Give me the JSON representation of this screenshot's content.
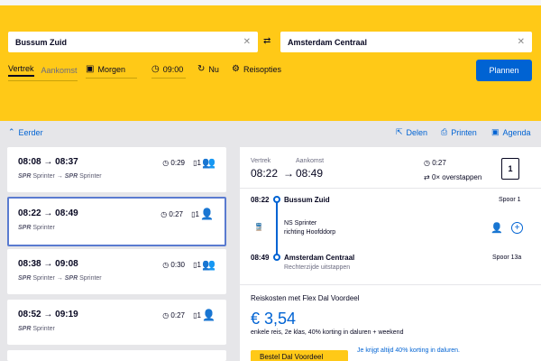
{
  "search": {
    "from": "Bussum Zuid",
    "to": "Amsterdam Centraal",
    "tab_departure": "Vertrek",
    "tab_arrival": "Aankomst",
    "date": "Morgen",
    "time": "09:00",
    "now": "Nu",
    "options": "Reisopties",
    "plan": "Plannen"
  },
  "toolbar": {
    "earlier": "Eerder",
    "share": "Delen",
    "print": "Printen",
    "agenda": "Agenda"
  },
  "trips": [
    {
      "times": "08:08 → 08:37",
      "train": "SPR",
      "train_label": "Sprinter",
      "train2": "SPR",
      "train2_label": "Sprinter",
      "duration": "0:29",
      "transfers": "1",
      "crowd": "orange"
    },
    {
      "times": "08:22 → 08:49",
      "train": "SPR",
      "train_label": "Sprinter",
      "train2": "",
      "train2_label": "",
      "duration": "0:27",
      "transfers": "1",
      "crowd": "green"
    },
    {
      "times": "08:38 → 09:08",
      "train": "SPR",
      "train_label": "Sprinter",
      "train2": "SPR",
      "train2_label": "Sprinter",
      "duration": "0:30",
      "transfers": "1",
      "crowd": "orange"
    },
    {
      "times": "08:52 → 09:19",
      "train": "SPR",
      "train_label": "Sprinter",
      "train2": "",
      "train2_label": "",
      "duration": "0:27",
      "transfers": "1",
      "crowd": "green"
    }
  ],
  "detail": {
    "label_departure": "Vertrek",
    "label_arrival": "Aankomst",
    "dep_time": "08:22",
    "arr_time": "08:49",
    "duration": "0:27",
    "transfers": "0× overstappen",
    "platform_count": "1",
    "stop1_time": "08:22",
    "stop1_name": "Bussum Zuid",
    "stop1_platform": "Spoor 1",
    "service": "NS Sprinter",
    "direction": "richting Hoofddorp",
    "stop2_time": "08:49",
    "stop2_name": "Amsterdam Centraal",
    "stop2_platform": "Spoor 13a",
    "exit_side": "Rechterzijde uitstappen",
    "cost_title": "Reiskosten met Flex Dal Voordeel",
    "price": "€ 3,54",
    "price_desc": "enkele reis, 2e klas, 40% korting in daluren + weekend",
    "cta": "Bestel Dal Voordeel",
    "note": "Je krijgt altijd 40% korting in daluren."
  },
  "colors": {
    "yellow": "#ffc917",
    "blue": "#0063d3",
    "green": "#38a83b",
    "orange": "#e88b00"
  }
}
